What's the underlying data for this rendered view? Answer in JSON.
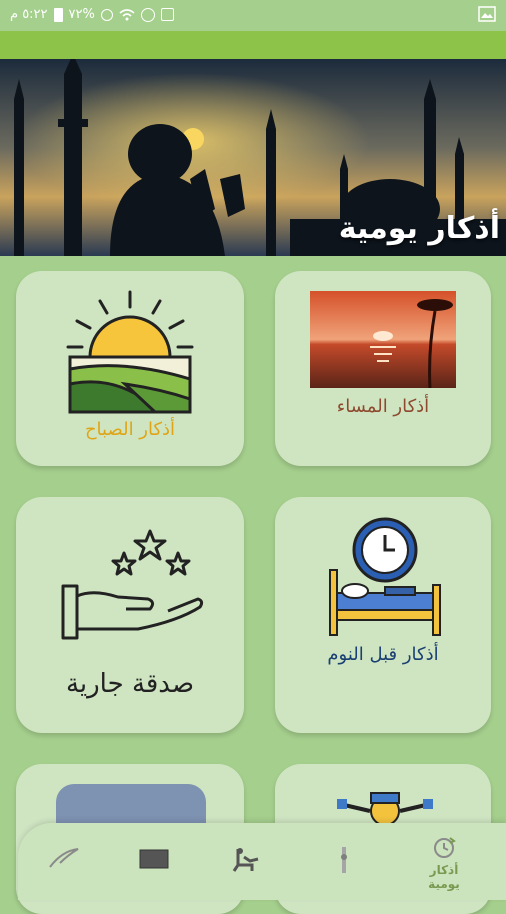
{
  "status_bar": {
    "time_text": "٥:٢٢ م",
    "battery_text": "٧٢%"
  },
  "header": {
    "title": "أذكار يومية"
  },
  "cards": {
    "evening": {
      "label": "أذكار المساء"
    },
    "morning": {
      "label": "أذكار الصباح"
    },
    "sleep": {
      "label": "أذكار قبل النوم"
    },
    "charity": {
      "label": "صدقة جارية"
    }
  },
  "bottom_nav": {
    "items": [
      {
        "label": "أذكار يومية",
        "icon": "daily-azkar-icon",
        "active": true
      },
      {
        "label": "",
        "icon": "tasbih-icon"
      },
      {
        "label": "",
        "icon": "prayer-icon"
      },
      {
        "label": "",
        "icon": "book-icon"
      },
      {
        "label": "",
        "icon": "feather-icon"
      }
    ]
  },
  "colors": {
    "background": "#a5cf8d",
    "accent_bar": "#8dc349",
    "card": "#cfe5c2",
    "morning_label": "#e0a516",
    "evening_label": "#8e4a2e",
    "sleep_label": "#1a3f72"
  }
}
